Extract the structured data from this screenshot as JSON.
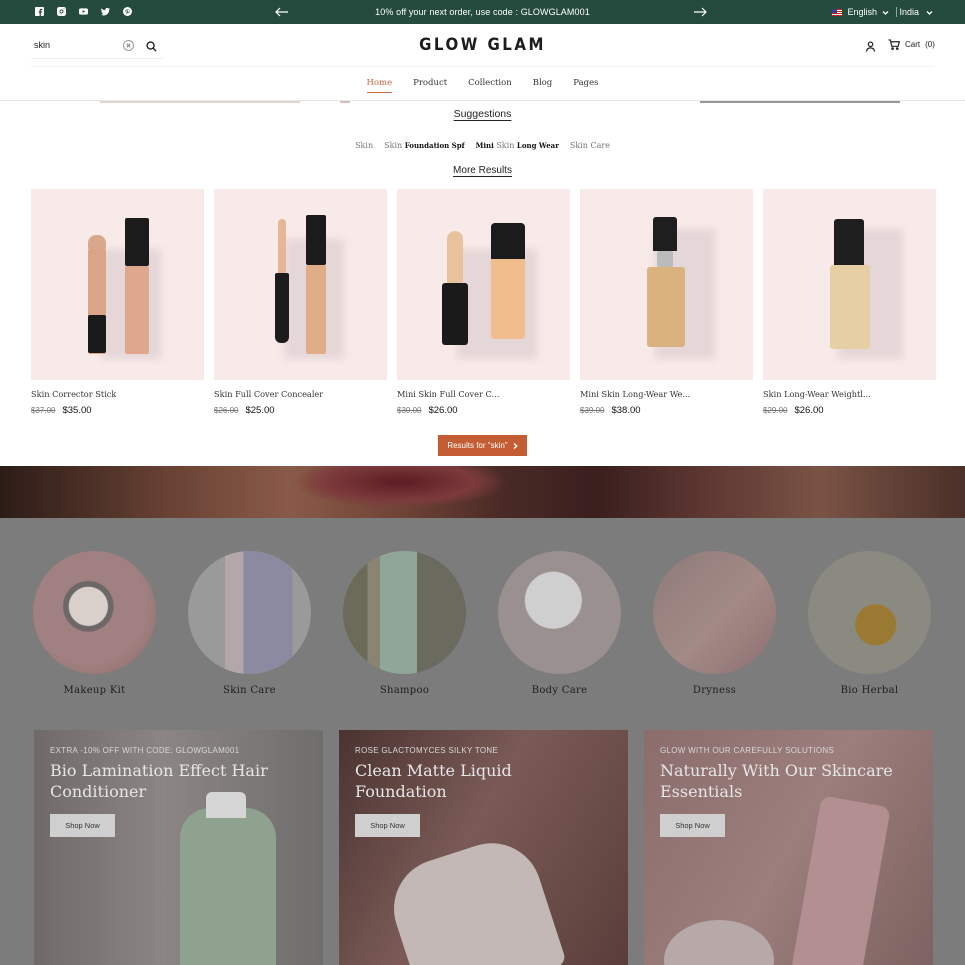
{
  "announcement": {
    "promo": "10% off your next order, use code : GLOWGLAM001",
    "language": "English",
    "country": "India"
  },
  "header": {
    "logo": "GLOW GLAM",
    "search_value": "skin",
    "cart_label": "Cart",
    "cart_count": "(0)",
    "nav": [
      {
        "label": "Home",
        "active": true
      },
      {
        "label": "Product"
      },
      {
        "label": "Collection"
      },
      {
        "label": "Blog"
      },
      {
        "label": "Pages"
      }
    ]
  },
  "search_panel": {
    "suggestions_title": "Suggestions",
    "suggestions": [
      {
        "prefix": "Skin",
        "bold": ""
      },
      {
        "prefix": "Skin",
        "bold": "Foundation Spf"
      },
      {
        "bold_prefix": "Mini",
        "prefix": "Skin",
        "bold": "Long Wear"
      },
      {
        "prefix": "Skin Care",
        "bold": ""
      }
    ],
    "more_results": "More Results",
    "results_button": "Results for \"skin\"",
    "products": [
      {
        "name": "Skin Corrector Stick",
        "old_price": "$37.00",
        "price": "$35.00"
      },
      {
        "name": "Skin Full Cover Concealer",
        "old_price": "$26.00",
        "price": "$25.00"
      },
      {
        "name": "Mini Skin Full Cover C...",
        "old_price": "$30.00",
        "price": "$26.00"
      },
      {
        "name": "Mini Skin Long-Wear We...",
        "old_price": "$39.00",
        "price": "$38.00"
      },
      {
        "name": "Skin Long-Wear Weightl...",
        "old_price": "$29.00",
        "price": "$26.00"
      }
    ]
  },
  "categories": [
    {
      "label": "Makeup Kit"
    },
    {
      "label": "Skin Care"
    },
    {
      "label": "Shampoo"
    },
    {
      "label": "Body Care"
    },
    {
      "label": "Dryness"
    },
    {
      "label": "Bio Herbal"
    }
  ],
  "banners": [
    {
      "kicker": "EXTRA -10% OFF WITH CODE: GLOWGLAM001",
      "title": "Bio Lamination Effect Hair Conditioner",
      "button": "Shop Now"
    },
    {
      "kicker": "ROSE GLACTOMYCES SILKY TONE",
      "title": "Clean Matte Liquid Foundation",
      "button": "Shop Now"
    },
    {
      "kicker": "GLOW WITH OUR CAREFULLY SOLUTIONS",
      "title": "Naturally With Our Skincare Essentials",
      "button": "Shop Now"
    }
  ],
  "colors": {
    "announcement_bg": "#254b3e",
    "accent": "#c45d33",
    "card_bg": "#f9eaea"
  }
}
